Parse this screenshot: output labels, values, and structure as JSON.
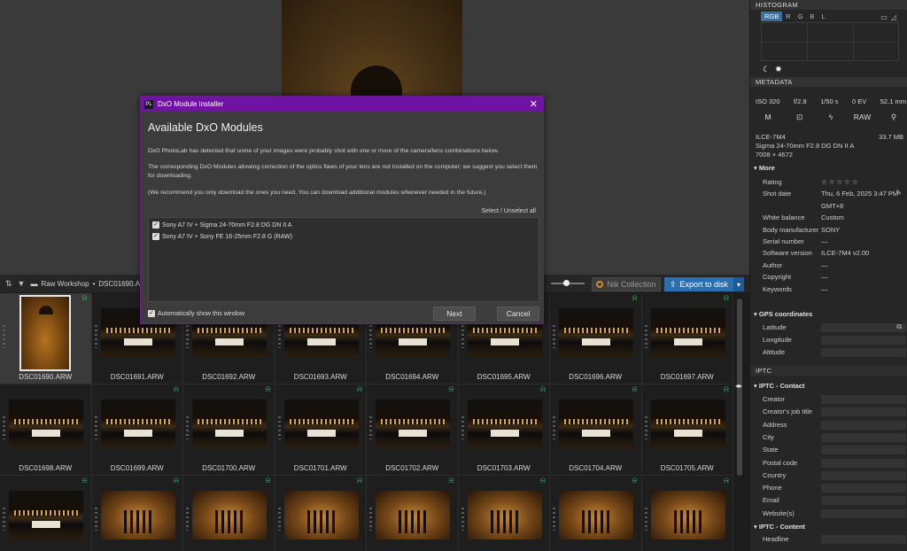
{
  "toolbar": {
    "breadcrumb_folder": "Raw Workshop",
    "breadcrumb_file": "DSC01690.ARW",
    "nik_label": "Nik Collection",
    "export_label": "Export to disk"
  },
  "grid": {
    "items": [
      {
        "name": "DSC01690.ARW",
        "kind": "portrait",
        "flag": true
      },
      {
        "name": "DSC01691.ARW",
        "kind": "room",
        "flag": false
      },
      {
        "name": "DSC01692.ARW",
        "kind": "room",
        "flag": false
      },
      {
        "name": "DSC01693.ARW",
        "kind": "room",
        "flag": false
      },
      {
        "name": "DSC01694.ARW",
        "kind": "room",
        "flag": false
      },
      {
        "name": "DSC01695.ARW",
        "kind": "room",
        "flag": false
      },
      {
        "name": "DSC01696.ARW",
        "kind": "room",
        "flag": true
      },
      {
        "name": "DSC01697.ARW",
        "kind": "room",
        "flag": true
      },
      {
        "name": "DSC01698.ARW",
        "kind": "room",
        "flag": false
      },
      {
        "name": "DSC01699.ARW",
        "kind": "room",
        "flag": true
      },
      {
        "name": "DSC01700.ARW",
        "kind": "room",
        "flag": true
      },
      {
        "name": "DSC01701.ARW",
        "kind": "room",
        "flag": true
      },
      {
        "name": "DSC01702.ARW",
        "kind": "room",
        "flag": true
      },
      {
        "name": "DSC01703.ARW",
        "kind": "room",
        "flag": true
      },
      {
        "name": "DSC01704.ARW",
        "kind": "room",
        "flag": true
      },
      {
        "name": "DSC01705.ARW",
        "kind": "room",
        "flag": true
      },
      {
        "name": "",
        "kind": "room",
        "flag": true
      },
      {
        "name": "",
        "kind": "stage",
        "flag": true
      },
      {
        "name": "",
        "kind": "stage",
        "flag": true
      },
      {
        "name": "",
        "kind": "stage",
        "flag": true
      },
      {
        "name": "",
        "kind": "stage",
        "flag": true
      },
      {
        "name": "",
        "kind": "stage",
        "flag": true
      },
      {
        "name": "",
        "kind": "stage",
        "flag": true
      },
      {
        "name": "",
        "kind": "stage",
        "flag": true
      }
    ]
  },
  "panel": {
    "histogram_title": "HISTOGRAM",
    "histogram_tabs": [
      "RGB",
      "R",
      "G",
      "B",
      "L"
    ],
    "metadata_title": "METADATA",
    "exif": {
      "iso": "ISO 320",
      "aperture": "f/2.8",
      "shutter": "1/50 s",
      "ev": "0 EV",
      "focal": "52.1 mm"
    },
    "exif_icons": {
      "mode": "M",
      "raw": "RAW"
    },
    "camera": "ILCE-7M4",
    "size": "33.7 MB",
    "lens": "Sigma 24-70mm F2.8 DG DN II A",
    "dimensions": "7008 × 4672",
    "more_title": "More",
    "fields": [
      {
        "k": "Rating",
        "v": "☆☆☆☆☆"
      },
      {
        "k": "Shot date",
        "v": "Thu, 6 Feb, 2025 3:47 PM"
      },
      {
        "k": "",
        "v": "GMT+8"
      },
      {
        "k": "White balance",
        "v": "Custom"
      },
      {
        "k": "Body manufacturer",
        "v": "SONY"
      },
      {
        "k": "Serial number",
        "v": "—"
      },
      {
        "k": "Software version",
        "v": "ILCE-7M4 v2.00"
      },
      {
        "k": "Author",
        "v": "—"
      },
      {
        "k": "Copyright",
        "v": "—"
      },
      {
        "k": "Keywords",
        "v": "—"
      }
    ],
    "gps_title": "GPS coordinates",
    "gps_fields": [
      "Latitude",
      "Longitude",
      "Altitude"
    ],
    "iptc_title": "IPTC",
    "iptc_contact_title": "IPTC - Contact",
    "iptc_contact_fields": [
      "Creator",
      "Creator's job title",
      "Address",
      "City",
      "State",
      "Postal code",
      "Country",
      "Phone",
      "Email",
      "Website(s)"
    ],
    "iptc_content_title": "IPTC - Content",
    "iptc_content_fields": [
      "Headline"
    ]
  },
  "dialog": {
    "title": "DxO Module installer",
    "heading": "Available DxO Modules",
    "para1": "DxO PhotoLab has detected that some of your images were probably shot with one or more of the camera/lens combinations below.",
    "para2": "The corresponding DxO Modules allowing correction of the optics flaws of your lens are not installed on the computer; we suggest you select them for downloading.",
    "para3": "(We recommend you only download the ones you need. You can download additional modules whenever needed in the future.)",
    "select_all": "Select / Unselect all",
    "modules": [
      "Sony A7 IV + Sigma 24-70mm F2.8 DG DN II A",
      "Sony A7 IV + Sony FE 16-25mm F2.8 G (RAW)"
    ],
    "auto_show": "Automatically show this window",
    "next_label": "Next",
    "cancel_label": "Cancel"
  }
}
